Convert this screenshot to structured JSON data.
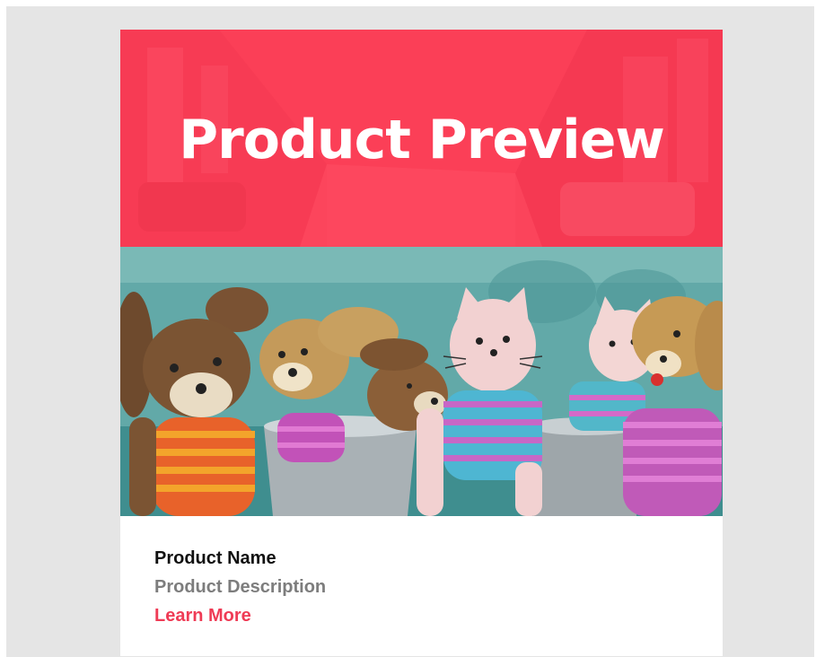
{
  "hero": {
    "title": "Product Preview",
    "background_color": "#fb3f57"
  },
  "photo": {
    "subject": "crocheted stuffed animals in metal buckets"
  },
  "product": {
    "name": "Product Name",
    "description": "Product Description",
    "link_label": "Learn More",
    "link_color": "#ef3b55"
  }
}
